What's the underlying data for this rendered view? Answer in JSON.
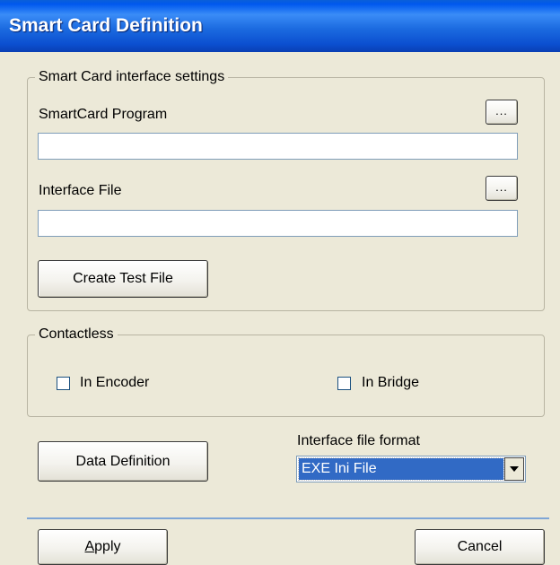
{
  "window": {
    "title": "Smart Card Definition"
  },
  "interface_group": {
    "label": "Smart Card interface settings",
    "program_label": "SmartCard Program",
    "program_value": "",
    "program_browse": "...",
    "interface_file_label": "Interface File",
    "interface_file_value": "",
    "interface_file_browse": "...",
    "create_test_file": "Create Test File"
  },
  "contactless_group": {
    "label": "Contactless",
    "in_encoder": {
      "label": "In Encoder",
      "checked": false
    },
    "in_bridge": {
      "label": "In Bridge",
      "checked": false
    }
  },
  "data_definition_button": "Data Definition",
  "format": {
    "label": "Interface file format",
    "selected": "EXE Ini File"
  },
  "footer": {
    "apply_underlined": "A",
    "apply_rest": "pply",
    "cancel": "Cancel"
  },
  "colors": {
    "title_bar": "#0a5fd8",
    "selection": "#316ac5",
    "divider": "#7fa6d6"
  }
}
